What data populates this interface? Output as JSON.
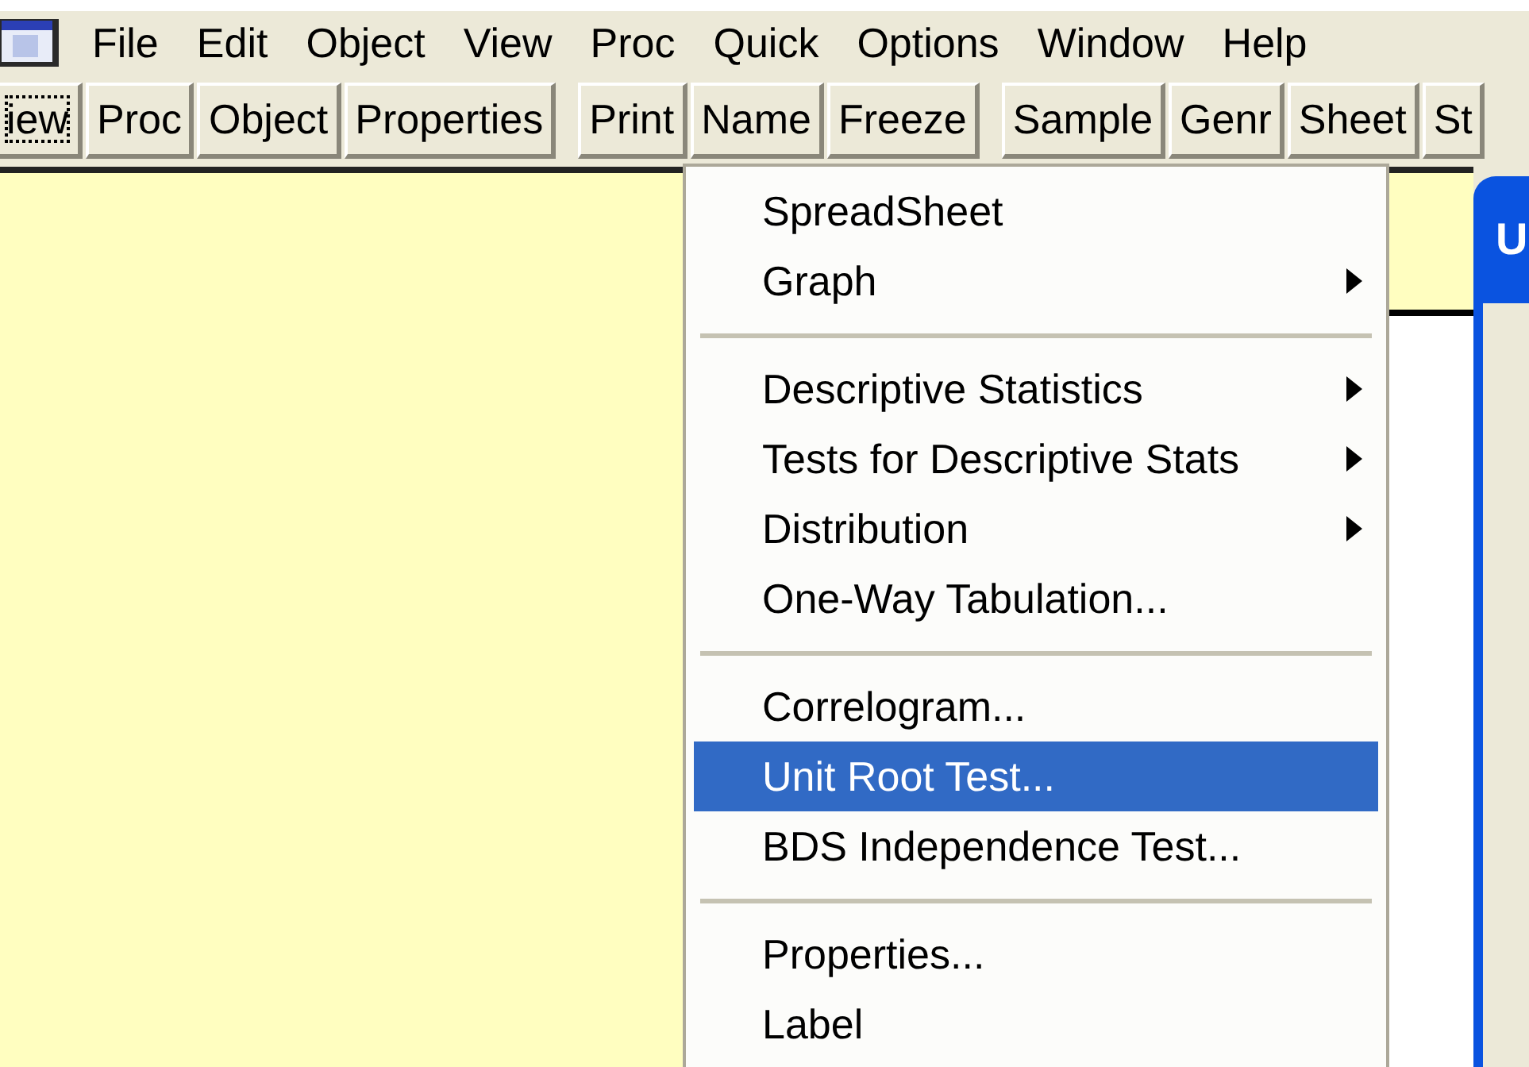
{
  "menu_bar": [
    "File",
    "Edit",
    "Object",
    "View",
    "Proc",
    "Quick",
    "Options",
    "Window",
    "Help"
  ],
  "toolbar_groups": [
    [
      {
        "label": "iew",
        "focused": true
      },
      {
        "label": "Proc",
        "focused": false
      },
      {
        "label": "Object",
        "focused": false
      },
      {
        "label": "Properties",
        "focused": false
      }
    ],
    [
      {
        "label": "Print",
        "focused": false
      },
      {
        "label": "Name",
        "focused": false
      },
      {
        "label": "Freeze",
        "focused": false
      }
    ],
    [
      {
        "label": "Sample",
        "focused": false
      },
      {
        "label": "Genr",
        "focused": false
      },
      {
        "label": "Sheet",
        "focused": false
      },
      {
        "label": "St",
        "focused": false
      }
    ]
  ],
  "context_menu": {
    "items": [
      {
        "kind": "item",
        "label": "SpreadSheet",
        "submenu": false,
        "selected": false
      },
      {
        "kind": "item",
        "label": "Graph",
        "submenu": true,
        "selected": false
      },
      {
        "kind": "separator"
      },
      {
        "kind": "item",
        "label": "Descriptive Statistics",
        "submenu": true,
        "selected": false
      },
      {
        "kind": "item",
        "label": "Tests for Descriptive Stats",
        "submenu": true,
        "selected": false
      },
      {
        "kind": "item",
        "label": "Distribution",
        "submenu": true,
        "selected": false
      },
      {
        "kind": "item",
        "label": "One-Way Tabulation...",
        "submenu": false,
        "selected": false
      },
      {
        "kind": "separator"
      },
      {
        "kind": "item",
        "label": "Correlogram...",
        "submenu": false,
        "selected": false
      },
      {
        "kind": "item",
        "label": "Unit Root Test...",
        "submenu": false,
        "selected": true
      },
      {
        "kind": "item",
        "label": "BDS Independence Test...",
        "submenu": false,
        "selected": false
      },
      {
        "kind": "separator"
      },
      {
        "kind": "item",
        "label": "Properties...",
        "submenu": false,
        "selected": false
      },
      {
        "kind": "item",
        "label": "Label",
        "submenu": false,
        "selected": false
      }
    ]
  },
  "dialog": {
    "title": "U"
  }
}
